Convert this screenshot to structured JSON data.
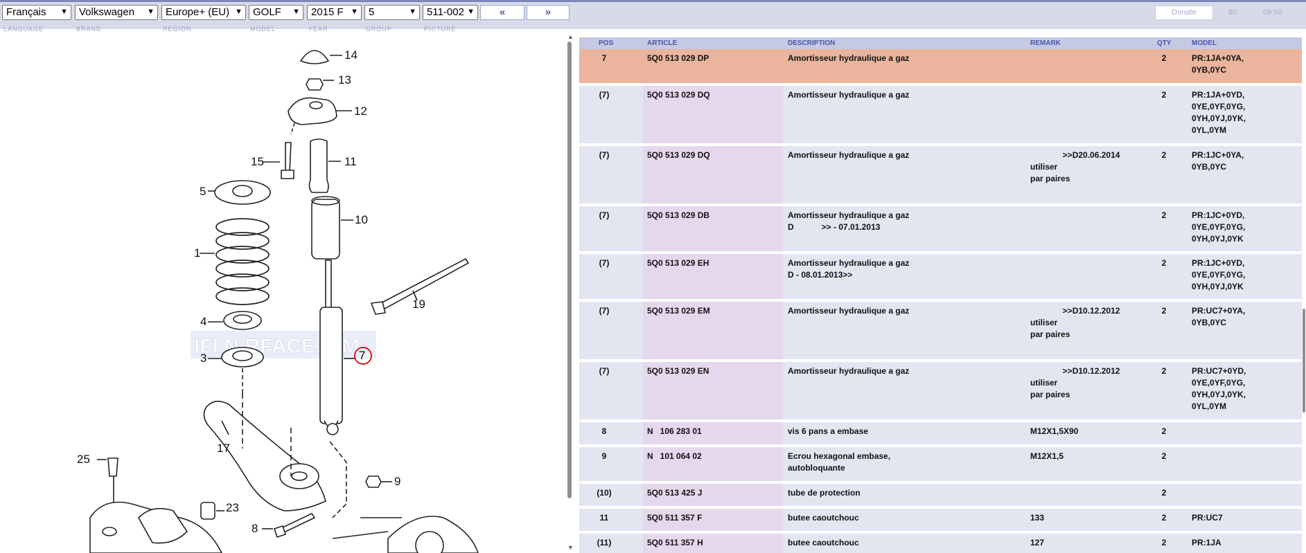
{
  "toolbar": {
    "selects": [
      {
        "name": "language-select",
        "value": "Français",
        "label": "LANGUAGE"
      },
      {
        "name": "brand-select",
        "value": "Volkswagen",
        "label": "BRAND"
      },
      {
        "name": "region-select",
        "value": "Europe+ (EU)",
        "label": "REGION"
      },
      {
        "name": "model-select",
        "value": "GOLF",
        "label": "MODEL"
      },
      {
        "name": "year-select",
        "value": "2015  F",
        "label": "YEAR"
      },
      {
        "name": "group-select",
        "value": "5",
        "label": "GROUP"
      },
      {
        "name": "picture-select",
        "value": "511-002",
        "label": "PICTURE"
      }
    ],
    "prev_label": "«",
    "next_label": "»",
    "donate_label": "Donate",
    "counter": "80",
    "time": "09:50"
  },
  "diagram": {
    "watermark": "IFI N RFACE.C M",
    "callouts": [
      "14",
      "13",
      "12",
      "15",
      "11",
      "5",
      "10",
      "1",
      "19",
      "4",
      "7",
      "3",
      "17",
      "25",
      "9",
      "23",
      "8"
    ]
  },
  "table": {
    "headers": {
      "pos": "POS",
      "article": "ARTICLE",
      "description": "DESCRIPTION",
      "remark": "REMARK",
      "qty": "QTY",
      "model": "MODEL"
    },
    "rows": [
      {
        "pos": "7",
        "article": "5Q0 513 029 DP",
        "description": "Amortisseur hydraulique a gaz",
        "remark": "",
        "qty": "2",
        "model": "PR:1JA+0YA,\n0YB,0YC",
        "highlight": true
      },
      {
        "pos": "(7)",
        "article": "5Q0 513 029 DQ",
        "description": "Amortisseur hydraulique a gaz",
        "remark": "",
        "qty": "2",
        "model": "PR:1JA+0YD,\n0YE,0YF,0YG,\n0YH,0YJ,0YK,\n0YL,0YM"
      },
      {
        "pos": "(7)",
        "article": "5Q0 513 029 DQ",
        "description": "Amortisseur hydraulique a gaz",
        "remark": "              >>D20.06.2014\nutiliser\npar paires",
        "qty": "2",
        "model": "PR:1JC+0YA,\n0YB,0YC"
      },
      {
        "pos": "(7)",
        "article": "5Q0 513 029 DB",
        "description": "Amortisseur hydraulique a gaz\nD            >> - 07.01.2013",
        "remark": "",
        "qty": "2",
        "model": "PR:1JC+0YD,\n0YE,0YF,0YG,\n0YH,0YJ,0YK"
      },
      {
        "pos": "(7)",
        "article": "5Q0 513 029 EH",
        "description": "Amortisseur hydraulique a gaz\nD - 08.01.2013>>",
        "remark": "",
        "qty": "2",
        "model": "PR:1JC+0YD,\n0YE,0YF,0YG,\n0YH,0YJ,0YK"
      },
      {
        "pos": "(7)",
        "article": "5Q0 513 029 EM",
        "description": "Amortisseur hydraulique a gaz",
        "remark": "              >>D10.12.2012\nutiliser\npar paires",
        "qty": "2",
        "model": "PR:UC7+0YA,\n0YB,0YC"
      },
      {
        "pos": "(7)",
        "article": "5Q0 513 029 EN",
        "description": "Amortisseur hydraulique a gaz",
        "remark": "              >>D10.12.2012\nutiliser\npar paires",
        "qty": "2",
        "model": "PR:UC7+0YD,\n0YE,0YF,0YG,\n0YH,0YJ,0YK,\n0YL,0YM"
      },
      {
        "pos": "8",
        "article": "N   106 283 01",
        "description": "vis 6 pans a embase",
        "remark": "M12X1,5X90",
        "qty": "2",
        "model": ""
      },
      {
        "pos": "9",
        "article": "N   101 064 02",
        "description": "Ecrou hexagonal embase,\nautobloquante",
        "remark": "M12X1,5",
        "qty": "2",
        "model": ""
      },
      {
        "pos": "(10)",
        "article": "5Q0 513 425 J",
        "description": "tube de protection",
        "remark": "",
        "qty": "2",
        "model": ""
      },
      {
        "pos": "11",
        "article": "5Q0 511 357 F",
        "description": "butee caoutchouc",
        "remark": "133",
        "qty": "2",
        "model": "PR:UC7"
      },
      {
        "pos": "(11)",
        "article": "5Q0 511 357 H",
        "description": "butee caoutchouc",
        "remark": "127",
        "qty": "2",
        "model": "PR:1JA"
      }
    ]
  }
}
